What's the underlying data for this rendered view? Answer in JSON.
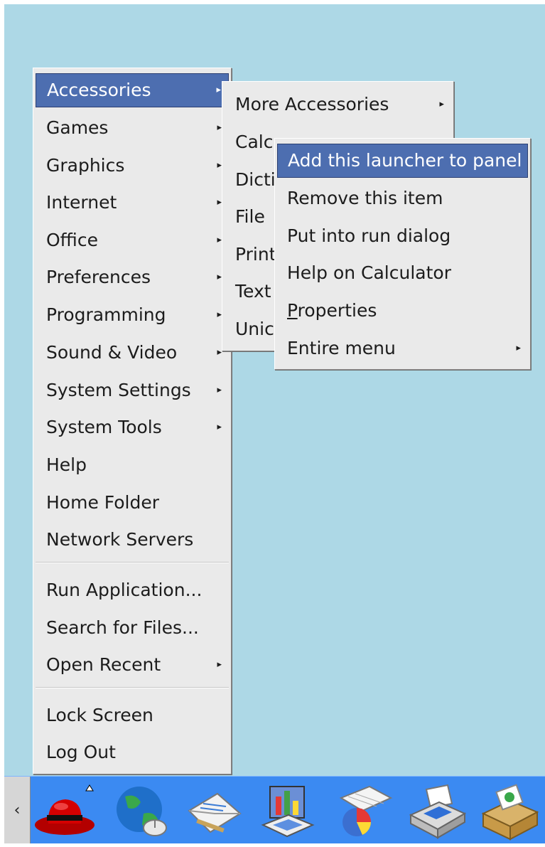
{
  "main_menu": {
    "items": [
      {
        "label": "Accessories",
        "submenu": true,
        "selected": true
      },
      {
        "label": "Games",
        "submenu": true
      },
      {
        "label": "Graphics",
        "submenu": true
      },
      {
        "label": "Internet",
        "submenu": true
      },
      {
        "label": "Office",
        "submenu": true
      },
      {
        "label": "Preferences",
        "submenu": true
      },
      {
        "label": "Programming",
        "submenu": true
      },
      {
        "label": "Sound & Video",
        "submenu": true
      },
      {
        "label": "System Settings",
        "submenu": true
      },
      {
        "label": "System Tools",
        "submenu": true
      },
      {
        "label": "Help"
      },
      {
        "label": "Home Folder"
      },
      {
        "label": "Network Servers"
      }
    ],
    "actions": [
      {
        "label": "Run Application..."
      },
      {
        "label": "Search for Files..."
      },
      {
        "label": "Open Recent",
        "submenu": true
      }
    ],
    "session": [
      {
        "label": "Lock Screen"
      },
      {
        "label": "Log Out"
      }
    ]
  },
  "accessories_menu": {
    "items": [
      {
        "label": "More Accessories",
        "submenu": true
      },
      {
        "label": "Calc"
      },
      {
        "label": "Dicti"
      },
      {
        "label": "File"
      },
      {
        "label": "Print"
      },
      {
        "label": "Text"
      },
      {
        "label": "Unic"
      }
    ]
  },
  "context_menu": {
    "items": [
      {
        "label": "Add this launcher to panel",
        "selected": true
      },
      {
        "label": "Remove this item"
      },
      {
        "label": "Put into run dialog"
      },
      {
        "label": "Help on Calculator"
      },
      {
        "label_mnemonic": "P",
        "label_rest": "roperties"
      },
      {
        "label": "Entire menu",
        "submenu": true
      }
    ]
  },
  "panel": {
    "scroll_arrow": "‹",
    "launchers": [
      {
        "icon": "red-hat-icon"
      },
      {
        "icon": "web-browser-icon"
      },
      {
        "icon": "email-icon"
      },
      {
        "icon": "office-writer-icon"
      },
      {
        "icon": "office-calc-icon"
      },
      {
        "icon": "printer-icon"
      },
      {
        "icon": "mail-package-icon"
      }
    ]
  },
  "arrow_glyph": "▸",
  "colors": {
    "desktop": "#add8e6",
    "panel": "#3b8af2",
    "menu_bg": "#eaeaea",
    "selection": "#4d6eb0"
  }
}
